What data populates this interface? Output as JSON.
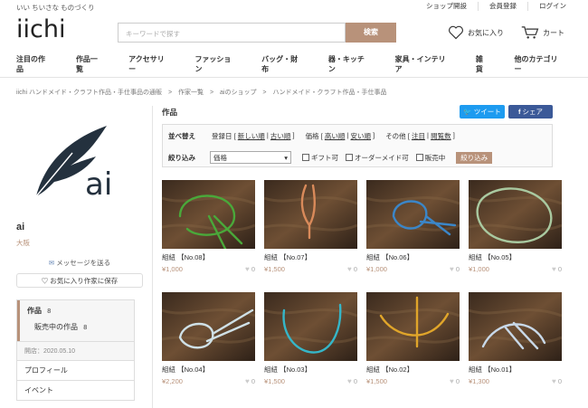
{
  "header": {
    "tagline": "いい ちいさな ものづくり",
    "links": [
      "ショップ開設",
      "会員登録",
      "ログイン"
    ],
    "logo": "iichi",
    "search_placeholder": "キーワードで探す",
    "search_button": "検索",
    "favorites": "お気に入り",
    "cart": "カート"
  },
  "nav": [
    "注目の作品",
    "作品一覧",
    "アクセサリー",
    "ファッション",
    "バッグ・財布",
    "器・キッチン",
    "家具・インテリア",
    "雑貨",
    "他のカテゴリー"
  ],
  "breadcrumb": [
    "iichi ハンドメイド・クラフト作品・手仕事品の通販",
    ">",
    "作家一覧",
    ">",
    "aiのショップ",
    ">",
    "ハンドメイド・クラフト作品・手仕事品"
  ],
  "shop": {
    "logo_text": "ai",
    "name": "ai",
    "location": "大阪",
    "message": "メッセージを送る",
    "save": "お気に入り作家に保存",
    "menu_works": "作品",
    "menu_works_count": "8",
    "menu_onsale": "販売中の作品",
    "menu_onsale_count": "8",
    "opened": "開店：2020.05.10",
    "profile": "プロフィール",
    "event": "イベント"
  },
  "main": {
    "title": "作品",
    "tweet": "ツイート",
    "share": "シェア",
    "sort_label": "並べ替え",
    "sort_reg": "登録日 [",
    "sort_new": "新しい順",
    "sort_sep1": "|",
    "sort_old": "古い順",
    "sort_end1": "]",
    "sort_price": "価格 [",
    "sort_high": "高い順",
    "sort_sep2": "|",
    "sort_low": "安い順",
    "sort_end2": "]",
    "sort_other": "その他 [",
    "sort_featured": "注目",
    "sort_sep3": "|",
    "sort_views": "閲覧数",
    "sort_end3": "]",
    "filter_label": "絞り込み",
    "filter_select": "価格",
    "filter_gift": "ギフト可",
    "filter_order": "オーダーメイド可",
    "filter_sale": "販売中",
    "filter_button": "絞り込み"
  },
  "products": [
    {
      "title": "組紐 【No.08】",
      "price": "¥1,000",
      "likes": "0",
      "cord": "#4aa83a"
    },
    {
      "title": "組紐 【No.07】",
      "price": "¥1,500",
      "likes": "0",
      "cord": "#d98a5a"
    },
    {
      "title": "組紐 【No.06】",
      "price": "¥1,000",
      "likes": "0",
      "cord": "#3b86c8"
    },
    {
      "title": "組紐 【No.05】",
      "price": "¥1,000",
      "likes": "0",
      "cord": "#a9c9a0"
    },
    {
      "title": "組紐 【No.04】",
      "price": "¥2,200",
      "likes": "0",
      "cord": "#cfe0e6"
    },
    {
      "title": "組紐 【No.03】",
      "price": "¥1,500",
      "likes": "0",
      "cord": "#35b6c8"
    },
    {
      "title": "組紐 【No.02】",
      "price": "¥1,500",
      "likes": "0",
      "cord": "#e0a52a"
    },
    {
      "title": "組紐 【No.01】",
      "price": "¥1,300",
      "likes": "0",
      "cord": "#c8d8e8"
    }
  ]
}
